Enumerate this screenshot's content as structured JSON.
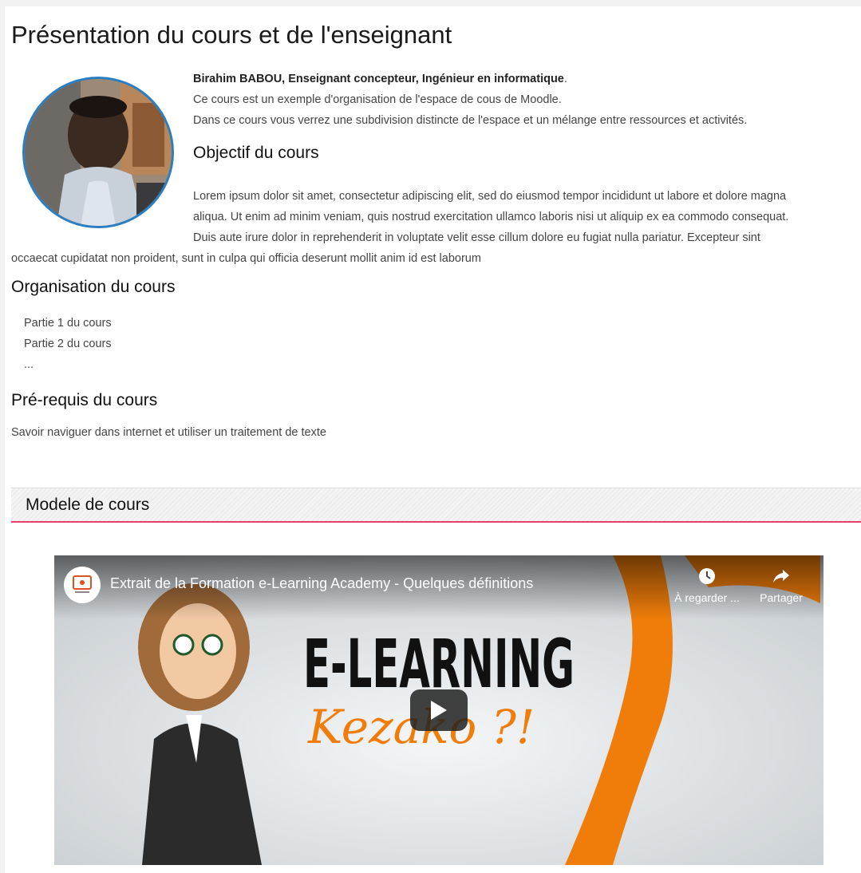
{
  "page_title": "Présentation du cours et de l'enseignant",
  "intro": {
    "author_bold": "Birahim BABOU, Enseignant concepteur, Ingénieur en informatique",
    "author_suffix": ".",
    "line2": "Ce cours est un exemple d'organisation de l'espace de cous de Moodle.",
    "line3": "Dans ce cours vous verrez une subdivision distincte de l'espace et un mélange entre ressources et activités."
  },
  "objective": {
    "title": "Objectif du cours",
    "lines": [
      "Lorem ipsum dolor sit amet, consectetur adipiscing elit, sed do eiusmod tempor incididunt ut labore et dolore magna",
      "aliqua. Ut enim ad minim veniam, quis nostrud exercitation ullamco laboris nisi ut aliquip ex ea commodo consequat.",
      "Duis aute irure dolor in reprehenderit in voluptate velit esse cillum dolore eu fugiat nulla pariatur. Excepteur sint",
      "occaecat cupidatat non proident, sunt in culpa qui officia deserunt mollit anim id est laborum"
    ]
  },
  "organisation": {
    "title": "Organisation du cours",
    "items": [
      "Partie 1 du cours",
      "Partie 2 du cours",
      "..."
    ]
  },
  "prerequisites": {
    "title": "Pré-requis du cours",
    "text": "Savoir naviguer dans internet et utiliser un traitement de texte"
  },
  "section": {
    "title": "Modele de cours"
  },
  "video": {
    "title": "Extrait de la Formation e-Learning Academy - Quelques définitions",
    "watch_later_label": "À regarder ...",
    "share_label": "Partager",
    "thumbnail_text_main": "E-LEARNING",
    "thumbnail_text_script": "Kezako ?!",
    "icons": {
      "watch_later": "clock-icon",
      "share": "share-arrow-icon",
      "play": "play-icon"
    }
  },
  "colors": {
    "accent_border": "#e83e6a",
    "avatar_ring": "#2a7ec2",
    "thumbnail_orange": "#f07d0a"
  }
}
